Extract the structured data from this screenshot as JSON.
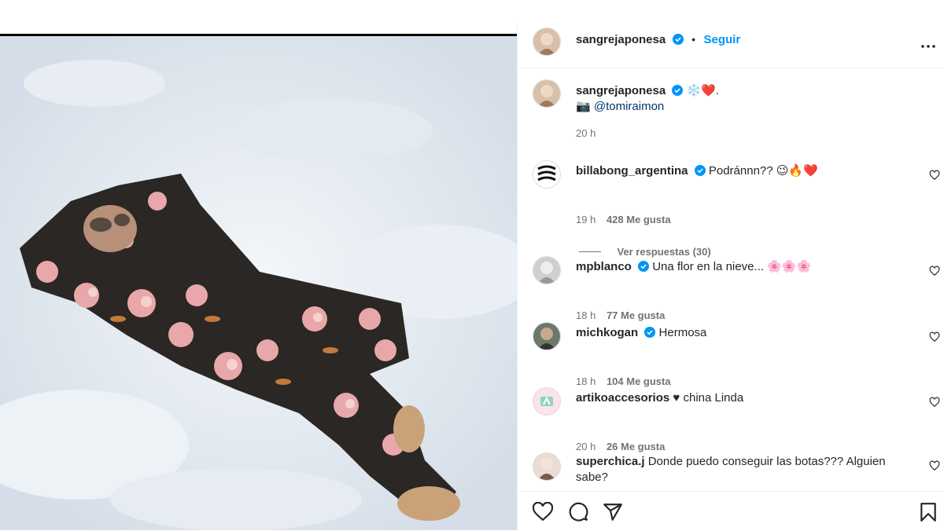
{
  "post": {
    "author": "sangrejaponesa",
    "follow_label": "Seguir",
    "separator": "•",
    "caption_emojis": "❄️❤️.",
    "caption_line2_prefix": "📷",
    "caption_mention": "@tomiraimon",
    "caption_time": "20 h"
  },
  "comments": [
    {
      "user": "billabong_argentina",
      "verified": true,
      "text": "Podránnn?? 😉🔥❤️",
      "time": "19 h",
      "likes": "428 Me gusta",
      "replies": "Ver respuestas (30)"
    },
    {
      "user": "mpblanco",
      "verified": true,
      "text": "Una flor en la nieve... 🌸🌸🌸",
      "time": "18 h",
      "likes": "77 Me gusta"
    },
    {
      "user": "michkogan",
      "verified": true,
      "text": "Hermosa",
      "time": "18 h",
      "likes": "104 Me gusta"
    },
    {
      "user": "artikoaccesorios",
      "verified": false,
      "text": "♥ china Linda",
      "time": "20 h",
      "likes": "26 Me gusta"
    },
    {
      "user": "superchica.j",
      "verified": false,
      "text": "Donde puedo conseguir las botas??? Alguien sabe?"
    }
  ],
  "colors": {
    "accent": "#0095f6",
    "verified": "#0095f6",
    "meta": "#737373",
    "text": "#262626"
  },
  "icons": [
    "like-icon",
    "comment-icon",
    "share-icon",
    "save-icon",
    "more-options-icon",
    "verified-badge-icon",
    "heart-small-icon"
  ]
}
